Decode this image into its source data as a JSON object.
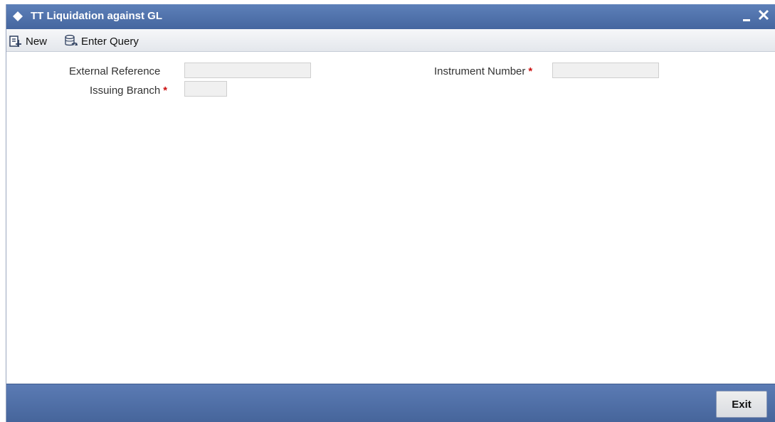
{
  "window": {
    "title": "TT Liquidation against GL",
    "title_icon": "diamond-icon",
    "controls": {
      "minimize_icon": "minimize-icon",
      "close_icon": "close-icon",
      "close_glyph": "✕"
    }
  },
  "toolbar": {
    "new_label": "New",
    "new_icon": "new-document-icon",
    "enter_query_label": "Enter Query",
    "enter_query_icon": "query-icon"
  },
  "form": {
    "external_reference": {
      "label": "External Reference",
      "value": "",
      "required": false
    },
    "issuing_branch": {
      "label": "Issuing Branch",
      "value": "",
      "required": true,
      "required_mark": "*"
    },
    "instrument_number": {
      "label": "Instrument Number",
      "value": "",
      "required": true,
      "required_mark": "*"
    }
  },
  "footer": {
    "exit_label": "Exit"
  },
  "colors": {
    "titlebar": "#4f72ad",
    "footer": "#5070aa",
    "required": "#cc1111",
    "field_background": "#f0f0f0"
  }
}
